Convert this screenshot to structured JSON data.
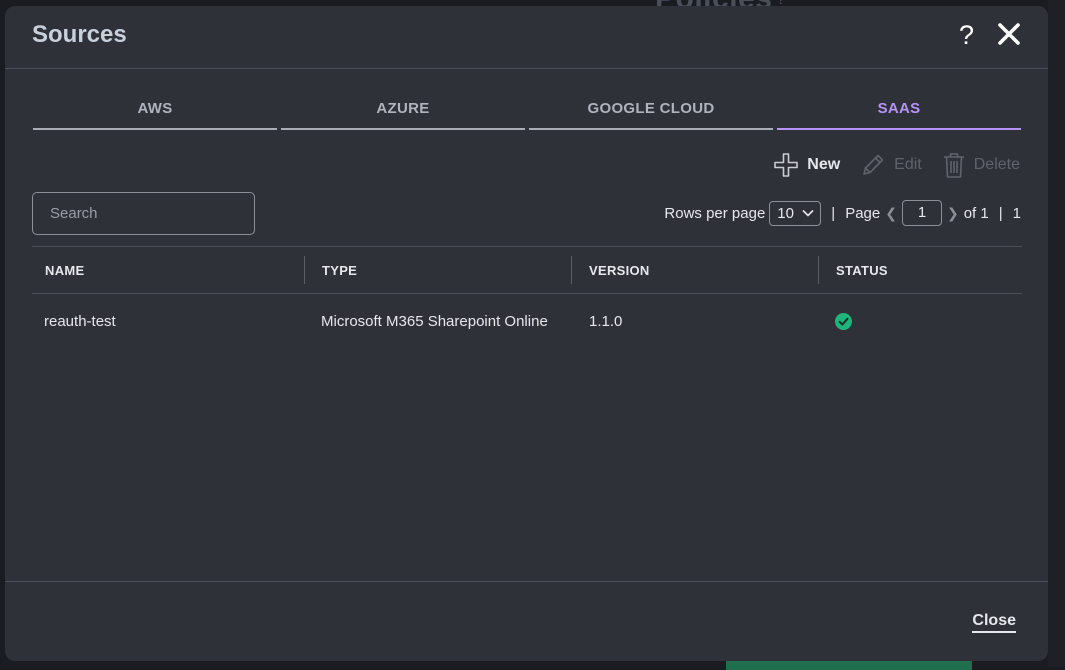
{
  "background": {
    "title": "Policies",
    "help_glyph": "?"
  },
  "dialog": {
    "title": "Sources",
    "help_glyph": "?",
    "tabs": [
      {
        "label": "AWS",
        "active": false
      },
      {
        "label": "AZURE",
        "active": false
      },
      {
        "label": "GOOGLE CLOUD",
        "active": false
      },
      {
        "label": "SAAS",
        "active": true
      }
    ],
    "actions": {
      "new_label": "New",
      "edit_label": "Edit",
      "delete_label": "Delete"
    },
    "search": {
      "placeholder": "Search",
      "value": ""
    },
    "pagination": {
      "rows_label": "Rows per page",
      "rows_value": "10",
      "page_label": "Page",
      "page_value": "1",
      "of_label": "of 1",
      "total": "1"
    },
    "table": {
      "columns": [
        "NAME",
        "TYPE",
        "VERSION",
        "STATUS"
      ],
      "rows": [
        {
          "name": "reauth-test",
          "type": "Microsoft M365 Sharepoint Online",
          "version": "1.1.0",
          "status": "ok"
        }
      ]
    },
    "footer": {
      "close_label": "Close"
    }
  },
  "colors": {
    "accent": "#b593f7",
    "status_ok": "#1fb47a",
    "dialog_bg": "#2f3138"
  },
  "icons": [
    "help-icon",
    "close-icon",
    "plus-icon",
    "pencil-icon",
    "trash-icon",
    "chevron-down-icon",
    "chevron-left-icon",
    "chevron-right-icon",
    "check-circle-icon"
  ]
}
